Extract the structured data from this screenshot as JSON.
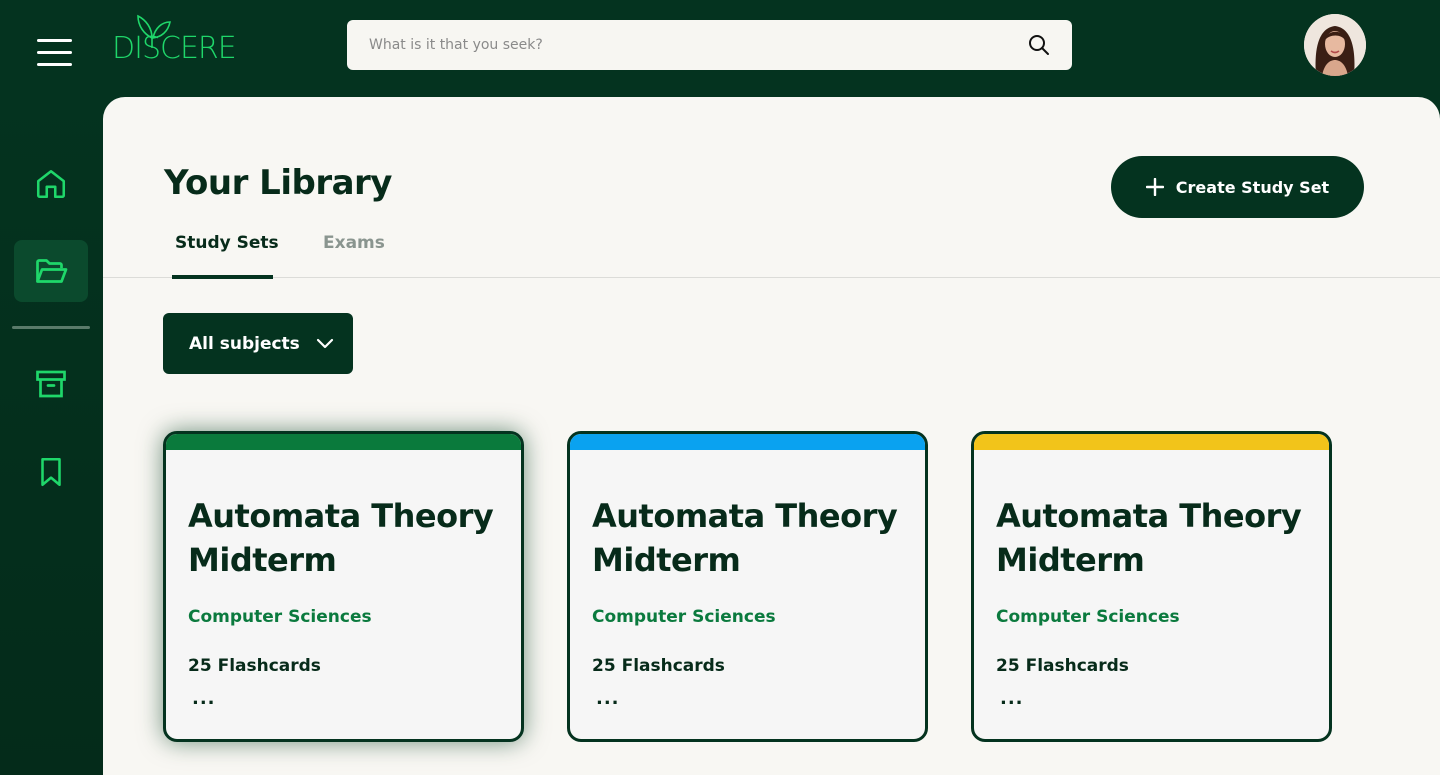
{
  "header": {
    "logo_text": "DISCERE",
    "search_placeholder": "What is it that you seek?"
  },
  "sidebar": {
    "items": [
      {
        "name": "home",
        "icon": "home-icon",
        "active": false
      },
      {
        "name": "library",
        "icon": "folder-open-icon",
        "active": true
      },
      {
        "name": "archive",
        "icon": "archive-icon",
        "active": false
      },
      {
        "name": "bookmarks",
        "icon": "bookmark-icon",
        "active": false
      }
    ]
  },
  "main": {
    "title": "Your Library",
    "create_label": "Create Study Set",
    "tabs": [
      {
        "label": "Study Sets",
        "active": true
      },
      {
        "label": "Exams",
        "active": false
      }
    ],
    "filter_label": "All subjects",
    "cards": [
      {
        "title": "Automata Theory Midterm",
        "subject": "Computer Sciences",
        "count": "25 Flashcards",
        "more": "...",
        "color": "#0a7a3c"
      },
      {
        "title": "Automata Theory Midterm",
        "subject": "Computer Sciences",
        "count": "25 Flashcards",
        "more": "...",
        "color": "#0aa2f0"
      },
      {
        "title": "Automata Theory Midterm",
        "subject": "Computer Sciences",
        "count": "25 Flashcards",
        "more": "...",
        "color": "#f2c41a"
      }
    ]
  },
  "colors": {
    "dark_green": "#04331f",
    "accent_green": "#1fd76a",
    "subject_green": "#0b7a3e",
    "page_bg": "#f8f7f3"
  }
}
